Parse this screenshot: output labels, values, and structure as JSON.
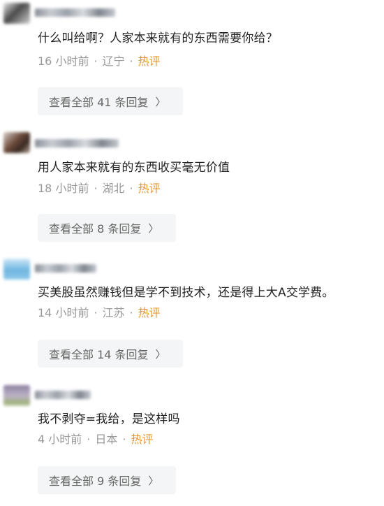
{
  "comments": [
    {
      "avatar_color": "#5b5b5b",
      "text": "什么叫给啊？人家本来就有的东西需要你给？",
      "time": "16 小时前",
      "location": "辽宁",
      "tag": "热评",
      "reply_label": "查看全部 41 条回复"
    },
    {
      "avatar_color": "#6b4a3a",
      "text": "用人家本来就有的东西收买毫无价值",
      "time": "18 小时前",
      "location": "湖北",
      "tag": "热评",
      "reply_label": "查看全部 8 条回复"
    },
    {
      "avatar_color": "#6fb6e0",
      "text": "买美股虽然赚钱但是学不到技术，还是得上大A交学费。",
      "time": "14 小时前",
      "location": "江苏",
      "tag": "热评",
      "reply_label": "查看全部 14 条回复"
    },
    {
      "avatar_color": "#8c7fa0",
      "text": "我不剥夺=我给，是这样吗",
      "time": "4 小时前",
      "location": "日本",
      "tag": "热评",
      "reply_label": "查看全部 9 条回复"
    }
  ],
  "chevron_icon": "chevron-right-icon",
  "colors": {
    "hot_tag": "#e8962e",
    "meta": "#999999",
    "reply_bg": "#f4f5f6"
  }
}
